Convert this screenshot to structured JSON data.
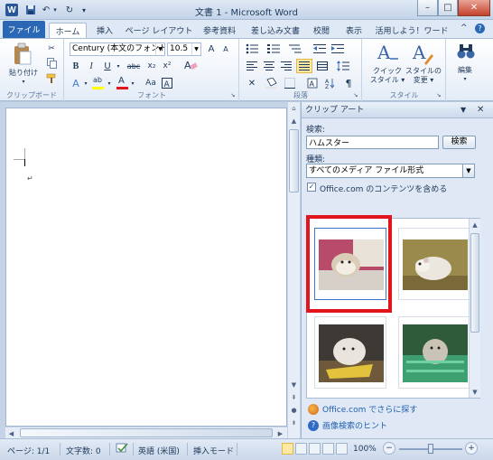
{
  "window": {
    "title": "文書 1 - Microsoft Word",
    "logo": "W",
    "min_glyph": "–",
    "max_glyph": "□",
    "close_glyph": "✕"
  },
  "qat": {
    "save_icon": "save-icon",
    "undo_icon": "undo-icon",
    "redo_icon": "redo-icon",
    "undo_glyph": "↶",
    "redo_glyph": "↻",
    "customize_glyph": "▾"
  },
  "tabs": {
    "file": "ファイル",
    "items": [
      "ホーム",
      "挿入",
      "ページ レイアウト",
      "参考資料",
      "差し込み文書",
      "校閲",
      "表示",
      "活用しよう！ワード"
    ],
    "active_index": 0,
    "help_glyph": "?",
    "minimize_glyph": "^"
  },
  "ribbon": {
    "clipboard": {
      "label": "クリップボード",
      "paste": "貼り付け"
    },
    "font": {
      "label": "フォント",
      "font_name": "Century (本文のフォント",
      "font_size": "10.5",
      "bold": "B",
      "italic": "I",
      "underline": "U",
      "strike": "abc",
      "sub": "x₂",
      "sup": "x²",
      "grow": "A",
      "shrink": "A",
      "change_case": "Aa",
      "clear": "A",
      "font_color": "A",
      "highlight": "ab"
    },
    "paragraph": {
      "label": "段落"
    },
    "styles": {
      "label": "スタイル",
      "quick": "クイック\nスタイル ▾",
      "change": "スタイルの\n変更 ▾"
    },
    "editing": {
      "label": "編集"
    },
    "colors": {
      "accent": "#2a68b5",
      "font_color_bar": "#e2141c",
      "highlight_bar": "#ffff00"
    }
  },
  "pane": {
    "title": "クリップ アート",
    "search_label": "検索:",
    "search_value": "ハムスター",
    "search_button": "検索",
    "type_label": "種類:",
    "type_value": "すべてのメディア ファイル形式",
    "include_office": "Office.com のコンテンツを含める",
    "include_checked": "✓",
    "link_more": "Office.com でさらに探す",
    "link_hint": "画像検索のヒント",
    "highlight_color": "#e2141c"
  },
  "status": {
    "page": "ページ: 1/1",
    "words": "文字数: 0",
    "language": "英語 (米国)",
    "mode": "挿入モード",
    "zoom": "100%",
    "zoom_minus": "−",
    "zoom_plus": "+"
  }
}
